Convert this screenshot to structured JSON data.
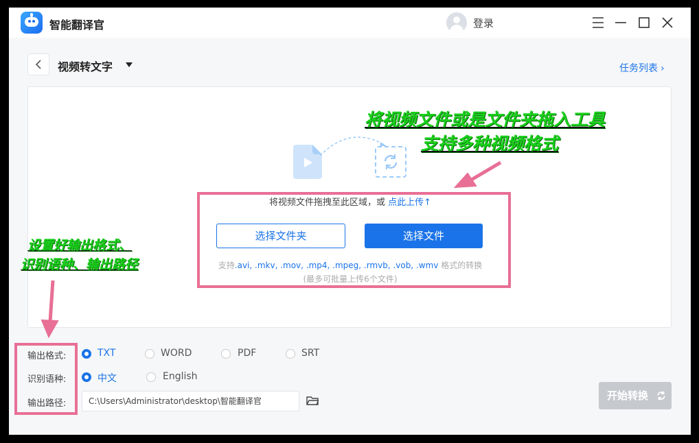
{
  "app": {
    "title": "智能翻译官",
    "login_label": "登录"
  },
  "window_controls": [
    "menu-icon",
    "minimize-icon",
    "maximize-icon",
    "close-icon"
  ],
  "header": {
    "title": "视频转文字",
    "task_list_label": "任务列表",
    "task_list_chevron": "›"
  },
  "drop": {
    "hint_text": "将视频文件拖拽至此区域，或",
    "upload_link": "点此上传",
    "upload_arrow": "↑",
    "select_folder_label": "选择文件夹",
    "select_file_label": "选择文件",
    "formats_prefix": "支持",
    "formats_list": ".avi, .mkv, .mov, .mp4, .mpeg, .rmvb, .vob, .wmv",
    "formats_suffix": " 格式的转换",
    "limit_text": "(最多可批量上传6个文件)"
  },
  "annotations": {
    "top_line1": "将视频文件或是文件夹拖入工具",
    "top_line2": "支持多种视频格式",
    "left_line1": "设置好输出格式、",
    "left_line2": "识别语种、输出路径"
  },
  "settings": {
    "format_label": "输出格式:",
    "formats": [
      {
        "label": "TXT",
        "selected": true
      },
      {
        "label": "WORD",
        "selected": false
      },
      {
        "label": "PDF",
        "selected": false
      },
      {
        "label": "SRT",
        "selected": false
      }
    ],
    "language_label": "识别语种:",
    "languages": [
      {
        "label": "中文",
        "selected": true
      },
      {
        "label": "English",
        "selected": false
      }
    ],
    "path_label": "输出路径:",
    "path_value": "C:\\Users\\Administrator\\desktop\\智能翻译官"
  },
  "start_button_label": "开始转换",
  "colors": {
    "accent": "#1a73e8",
    "highlight": "#e86f95",
    "annotation": "#19d01b",
    "disabled": "#c6c9ce"
  }
}
